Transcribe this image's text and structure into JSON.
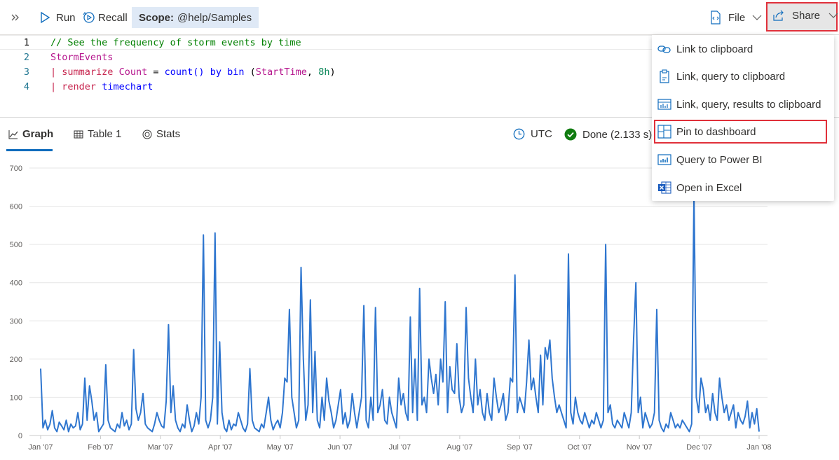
{
  "toolbar": {
    "run_label": "Run",
    "recall_label": "Recall",
    "scope_label": "Scope:",
    "scope_value": "@help/Samples",
    "file_label": "File",
    "share_label": "Share"
  },
  "editor": {
    "line_numbers": [
      "1",
      "2",
      "3",
      "4"
    ],
    "line1": "// See the frequency of storm events by time",
    "line2": "StormEvents",
    "line3": {
      "pipe": "|",
      "summarize": "summarize",
      "count_col": "Count",
      "eq": "=",
      "count_fn": "count()",
      "by": "by",
      "bin": "bin",
      "open": "(",
      "col": "StartTime",
      "comma": ",",
      "num": "8h",
      "close": ")"
    },
    "line4": {
      "pipe": "|",
      "render": "render",
      "kind": "timechart"
    }
  },
  "tabs": {
    "graph": "Graph",
    "table": "Table 1",
    "stats": "Stats"
  },
  "status": {
    "timezone": "UTC",
    "done": "Done (2.133 s)"
  },
  "share_menu": {
    "items": [
      "Link to clipboard",
      "Link, query to clipboard",
      "Link, query, results to clipboard",
      "Pin to dashboard",
      "Query to Power BI",
      "Open in Excel"
    ],
    "highlighted": "Pin to dashboard"
  },
  "colors": {
    "series": "#2f76cf",
    "highlight_border": "#e0303a",
    "tab_accent": "#0f6cbd",
    "scope_bg": "#dfe9f6",
    "done_green": "#107c10"
  },
  "chart_data": {
    "type": "line",
    "title": "",
    "xlabel": "",
    "ylabel": "",
    "ylim": [
      0,
      700
    ],
    "yticks": [
      "0",
      "100",
      "200",
      "300",
      "400",
      "500",
      "600",
      "700"
    ],
    "xticks": [
      "Jan '07",
      "Feb '07",
      "Mar '07",
      "Apr '07",
      "May '07",
      "Jun '07",
      "Jul '07",
      "Aug '07",
      "Sep '07",
      "Oct '07",
      "Nov '07",
      "Dec '07",
      "Jan '08"
    ],
    "grid": true,
    "legend": "none",
    "series": [
      {
        "values": [
          175,
          20,
          40,
          15,
          30,
          65,
          20,
          10,
          35,
          25,
          15,
          40,
          10,
          30,
          20,
          25,
          60,
          15,
          30,
          150,
          40,
          130,
          90,
          40,
          60,
          10,
          20,
          30,
          185,
          40,
          20,
          15,
          10,
          30,
          20,
          60,
          25,
          40,
          15,
          30,
          225,
          70,
          40,
          60,
          110,
          30,
          20,
          15,
          10,
          30,
          60,
          40,
          25,
          20,
          90,
          290,
          60,
          130,
          40,
          20,
          10,
          30,
          20,
          80,
          40,
          10,
          25,
          60,
          30,
          100,
          525,
          40,
          20,
          40,
          100,
          530,
          30,
          245,
          60,
          20,
          10,
          40,
          15,
          30,
          25,
          60,
          40,
          20,
          10,
          30,
          175,
          40,
          20,
          15,
          10,
          30,
          20,
          60,
          100,
          40,
          15,
          30,
          40,
          20,
          60,
          150,
          140,
          330,
          100,
          60,
          20,
          40,
          440,
          200,
          40,
          80,
          355,
          60,
          220,
          40,
          20,
          100,
          40,
          150,
          90,
          60,
          20,
          40,
          80,
          120,
          30,
          60,
          20,
          40,
          110,
          60,
          20,
          60,
          100,
          340,
          40,
          20,
          100,
          40,
          335,
          60,
          80,
          120,
          40,
          30,
          100,
          60,
          40,
          20,
          150,
          80,
          110,
          60,
          40,
          310,
          60,
          200,
          40,
          385,
          80,
          100,
          60,
          200,
          150,
          110,
          160,
          80,
          200,
          140,
          350,
          60,
          180,
          120,
          110,
          240,
          100,
          60,
          80,
          335,
          150,
          100,
          60,
          200,
          80,
          120,
          60,
          40,
          110,
          60,
          40,
          150,
          100,
          60,
          80,
          110,
          40,
          60,
          150,
          140,
          420,
          60,
          100,
          80,
          60,
          140,
          250,
          120,
          150,
          100,
          60,
          210,
          80,
          230,
          200,
          250,
          150,
          100,
          60,
          80,
          60,
          40,
          20,
          475,
          60,
          30,
          100,
          60,
          40,
          30,
          60,
          40,
          20,
          40,
          30,
          60,
          40,
          20,
          40,
          500,
          60,
          80,
          30,
          20,
          40,
          30,
          20,
          60,
          40,
          20,
          60,
          250,
          400,
          60,
          100,
          20,
          60,
          40,
          20,
          30,
          60,
          330,
          40,
          20,
          10,
          30,
          20,
          60,
          40,
          20,
          30,
          20,
          40,
          30,
          20,
          10,
          30,
          640,
          100,
          60,
          150,
          120,
          60,
          80,
          40,
          110,
          60,
          40,
          150,
          100,
          60,
          80,
          40,
          60,
          80,
          20,
          60,
          40,
          30,
          50,
          90,
          20,
          60,
          30,
          70,
          10
        ]
      }
    ]
  }
}
